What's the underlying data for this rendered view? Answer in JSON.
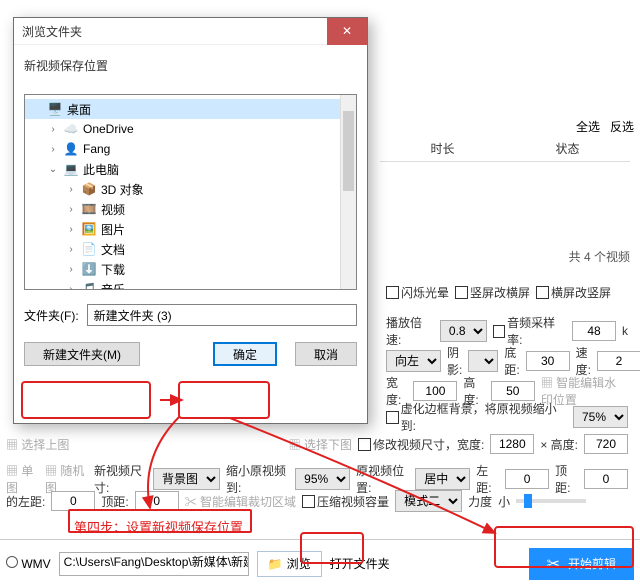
{
  "dialog": {
    "title": "浏览文件夹",
    "sub": "新视频保存位置",
    "folder_label": "文件夹(F):",
    "folder_value": "新建文件夹 (3)",
    "newfolder": "新建文件夹(M)",
    "ok": "确定",
    "cancel": "取消",
    "tree": [
      {
        "indent": 0,
        "arrow": "",
        "icon": "🖥️",
        "label": "桌面",
        "sel": true
      },
      {
        "indent": 1,
        "arrow": "›",
        "icon": "☁️",
        "label": "OneDrive"
      },
      {
        "indent": 1,
        "arrow": "›",
        "icon": "👤",
        "label": "Fang"
      },
      {
        "indent": 1,
        "arrow": "⌄",
        "icon": "💻",
        "label": "此电脑"
      },
      {
        "indent": 2,
        "arrow": "›",
        "icon": "📦",
        "label": "3D 对象"
      },
      {
        "indent": 2,
        "arrow": "›",
        "icon": "🎞️",
        "label": "视频"
      },
      {
        "indent": 2,
        "arrow": "›",
        "icon": "🖼️",
        "label": "图片"
      },
      {
        "indent": 2,
        "arrow": "›",
        "icon": "📄",
        "label": "文档"
      },
      {
        "indent": 2,
        "arrow": "›",
        "icon": "⬇️",
        "label": "下载"
      },
      {
        "indent": 2,
        "arrow": "›",
        "icon": "🎵",
        "label": "音乐"
      }
    ]
  },
  "topchk": {
    "all": "全选",
    "inv": "反选"
  },
  "cols": {
    "dur": "时长",
    "status": "状态"
  },
  "count": "共 4 个视频",
  "r1": {
    "a": "闪烁光晕",
    "b": "竖屏改横屏",
    "c": "横屏改竖屏"
  },
  "r2": {
    "a": "播放倍速:",
    "v1": "0.8",
    "b": "音频采样率:",
    "v2": "48",
    "u": "k"
  },
  "r3": {
    "a": "向左",
    "b": "阴影:",
    "c": "底距:",
    "v1": "30",
    "d": "速度:",
    "v2": "2"
  },
  "r4": {
    "a": "宽度:",
    "v1": "100",
    "b": "高度:",
    "v2": "50",
    "c": "智能编辑水印位置"
  },
  "r5": {
    "a": "虚化边框背景，将原视频缩小到:",
    "v": "75%"
  },
  "r6": {
    "a": "选择上图",
    "b": "选择下图",
    "c": "修改视频尺寸，宽度:",
    "v1": "1280",
    "d": "× 高度:",
    "v2": "720"
  },
  "r7": {
    "a": "单图",
    "b": "随机图",
    "c": "新视频尺寸:",
    "s1": "背景图",
    "d": "缩小原视频到:",
    "s2": "95%",
    "e": "原视频位置:",
    "s3": "居中",
    "f": "左距:",
    "v1": "0",
    "g": "顶距:",
    "v2": "0"
  },
  "r8": {
    "a": "的左距:",
    "v1": "0",
    "b": "顶距:",
    "v2": "0",
    "c": "智能编辑裁切区域",
    "d": "压缩视频容量",
    "s": "模式二",
    "e": "力度",
    "f": "小"
  },
  "note": "第四步：设置新视频保存位置",
  "bottom": {
    "wmv": "WMV",
    "path": "C:\\Users\\Fang\\Desktop\\新媒体\\新建",
    "browse": "浏览",
    "open": "打开文件夹",
    "start": "开始剪辑"
  }
}
